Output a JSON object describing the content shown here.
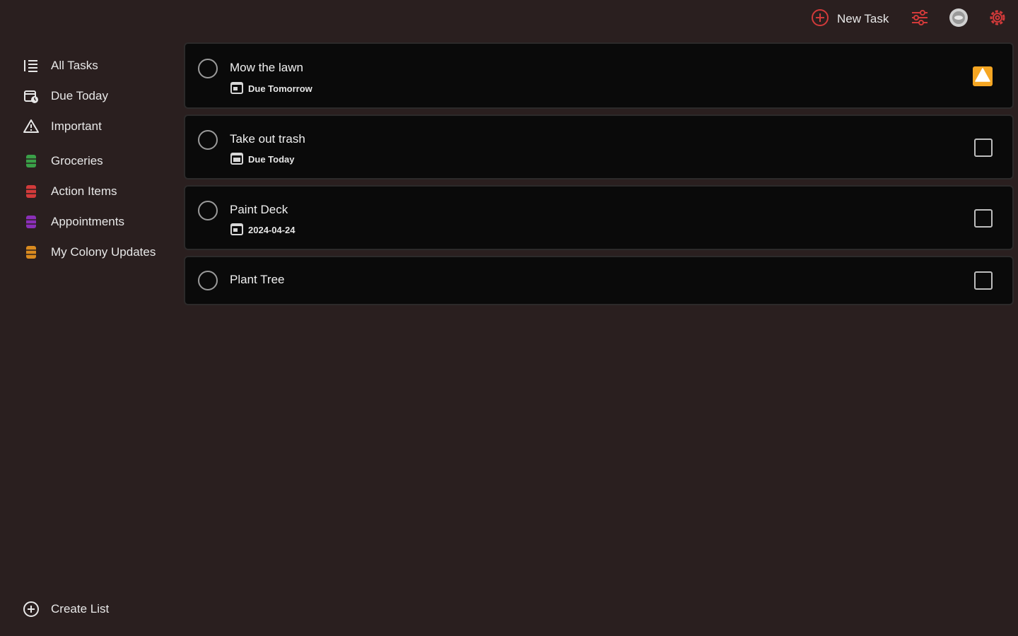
{
  "topbar": {
    "new_task_label": "New Task"
  },
  "sidebar": {
    "items": [
      {
        "label": "All Tasks",
        "icon": "list-icon"
      },
      {
        "label": "Due Today",
        "icon": "calendar-clock-icon"
      },
      {
        "label": "Important",
        "icon": "warning-icon"
      }
    ],
    "lists": [
      {
        "label": "Groceries",
        "icon": "list-bucket-icon",
        "color": "#3aa048"
      },
      {
        "label": "Action Items",
        "icon": "list-bucket-icon",
        "color": "#d23a3a"
      },
      {
        "label": "Appointments",
        "icon": "list-bucket-icon",
        "color": "#8a2fb8"
      },
      {
        "label": "My Colony Updates",
        "icon": "list-bucket-icon",
        "color": "#d98a1f"
      }
    ],
    "create_list_label": "Create List"
  },
  "tasks": [
    {
      "title": "Mow the lawn",
      "due": "Due Tomorrow",
      "important": true
    },
    {
      "title": "Take out trash",
      "due": "Due Today",
      "important": false
    },
    {
      "title": "Paint Deck",
      "due": "2024-04-24",
      "important": false
    },
    {
      "title": "Plant Tree",
      "due": "",
      "important": false
    }
  ],
  "colors": {
    "accent": "#d23a3a",
    "important_flag": "#f5a623",
    "background": "#2a1f1f",
    "card": "#0a0a0a"
  }
}
